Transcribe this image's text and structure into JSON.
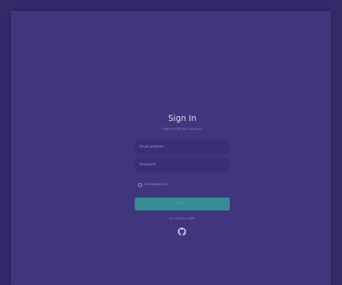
{
  "signin": {
    "title": "Sign In",
    "subtitle": "Sign in with your account",
    "email_placeholder": "Email address",
    "password_placeholder": "Password",
    "remember_label": "Remember me",
    "submit_label": "Sign in",
    "alt_text": "or continue with",
    "alt_provider_icon": "github-icon"
  },
  "colors": {
    "background": "#35296a",
    "panel": "#40367d",
    "field": "#3a2f76",
    "accent": "#358c93"
  }
}
